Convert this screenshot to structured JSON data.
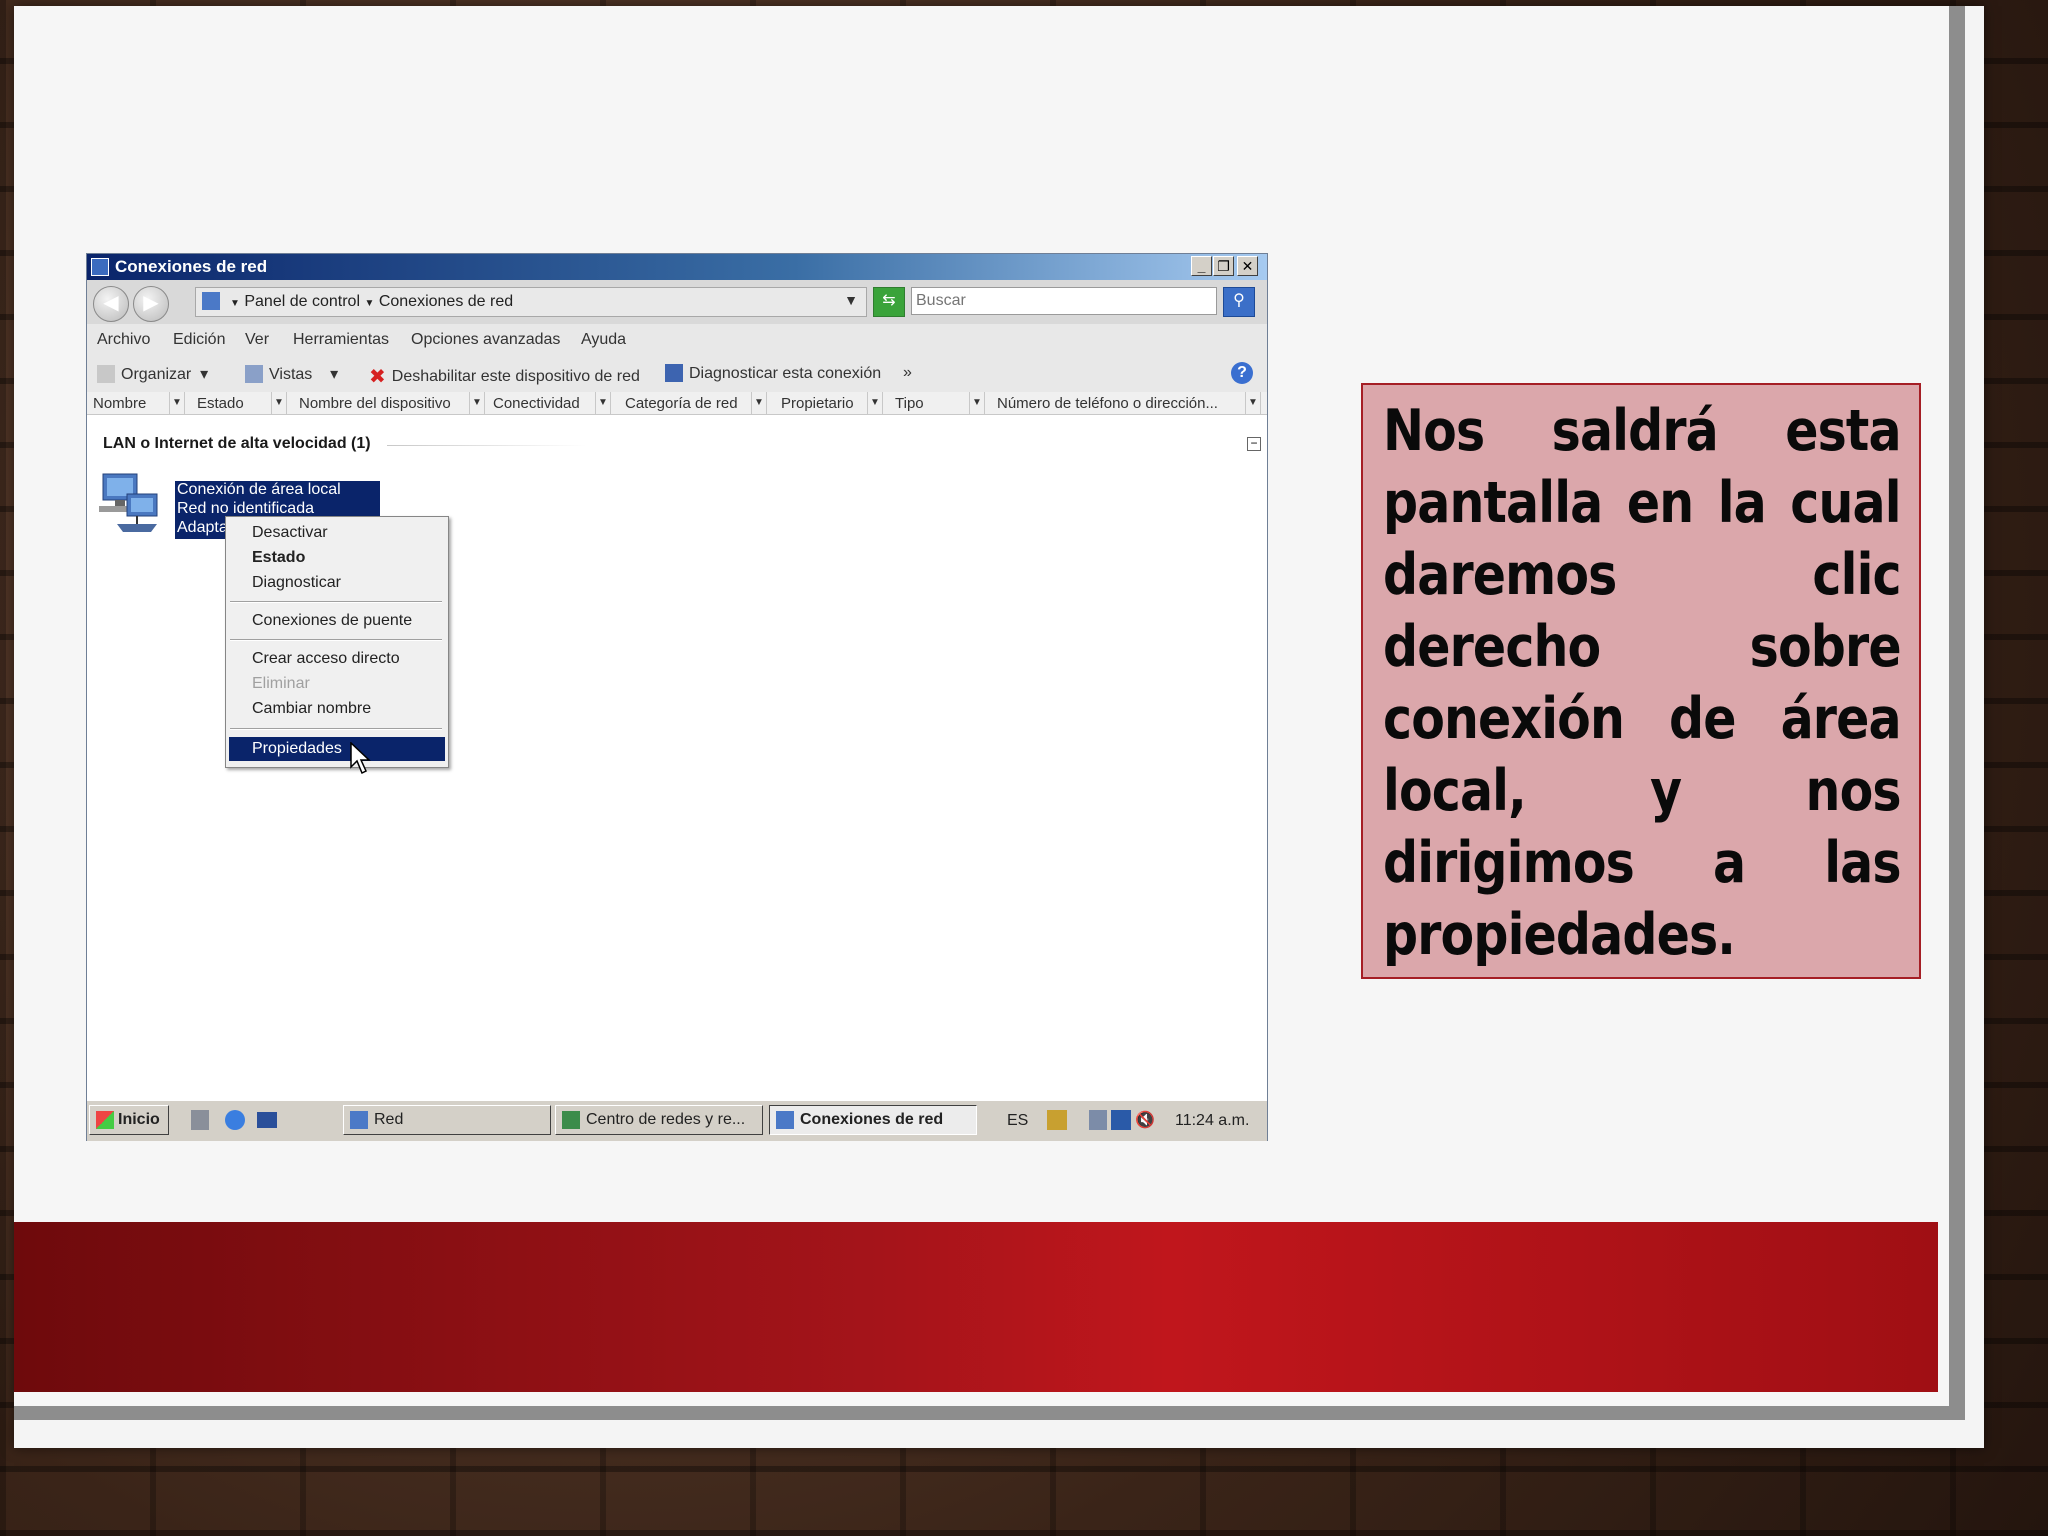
{
  "window": {
    "title": "Conexiones de red",
    "address": "Panel de control  ▸  Conexiones de red",
    "address_part1": "Panel de control",
    "address_part2": "Conexiones de red",
    "search_placeholder": "Buscar"
  },
  "menu": [
    "Archivo",
    "Edición",
    "Ver",
    "Herramientas",
    "Opciones avanzadas",
    "Ayuda"
  ],
  "toolbar": {
    "organize": "Organizar",
    "views": "Vistas",
    "disable": "Deshabilitar este dispositivo de red",
    "diagnose": "Diagnosticar esta conexión",
    "more": "»"
  },
  "columns": [
    "Nombre",
    "Estado",
    "Nombre del dispositivo",
    "Conectividad",
    "Categoría de red",
    "Propietario",
    "Tipo",
    "Número de teléfono o dirección..."
  ],
  "group": {
    "title": "LAN o Internet de alta velocidad (1)"
  },
  "connection": {
    "name": "Conexión de área local",
    "status": "Red no identificada",
    "adapter": "Adapta"
  },
  "context_menu": {
    "deactivate": "Desactivar",
    "status": "Estado",
    "diagnose": "Diagnosticar",
    "bridge": "Conexiones de puente",
    "shortcut": "Crear acceso directo",
    "delete": "Eliminar",
    "rename": "Cambiar nombre",
    "properties": "Propiedades"
  },
  "taskbar": {
    "start": "Inicio",
    "task1": "Red",
    "task2": "Centro de redes y re...",
    "task3": "Conexiones de red",
    "lang": "ES",
    "clock": "11:24 a.m."
  },
  "note": "Nos saldrá esta pantalla en la cual daremos clic derecho sobre conexión de área local, y nos dirigimos a las propiedades.",
  "colors": {
    "selection": "#0a246a",
    "note_bg": "#dba7ab",
    "note_border": "#a51e25",
    "band": "#b3141a"
  }
}
